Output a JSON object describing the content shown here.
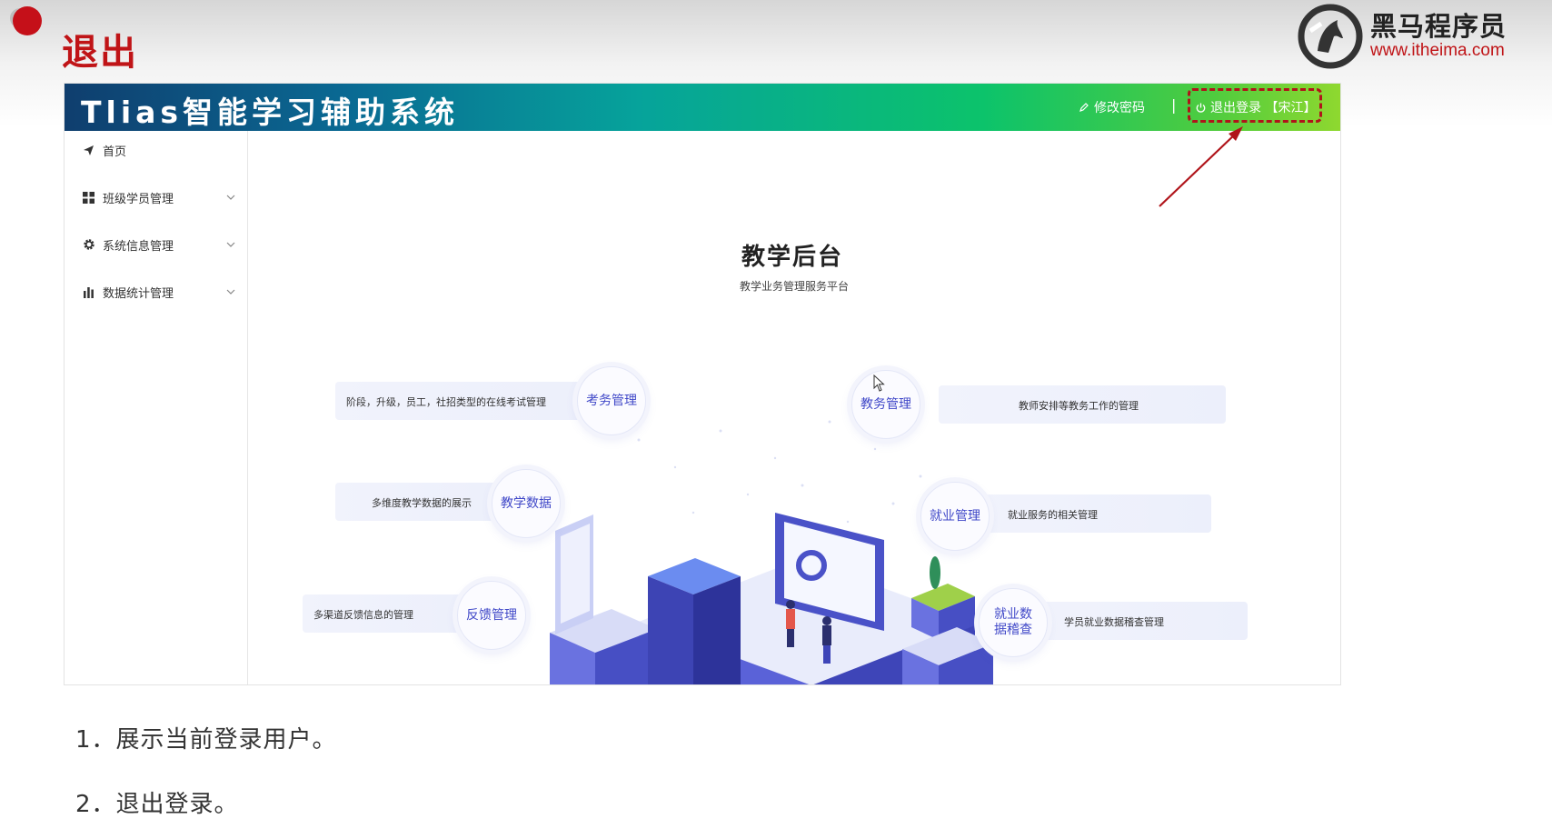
{
  "slide": {
    "title": "退出",
    "brand_name": "黑马程序员",
    "brand_url": "www.itheima.com"
  },
  "app": {
    "title": "Tlias智能学习辅助系统",
    "header": {
      "change_password": "修改密码",
      "separator": "|",
      "logout": "退出登录 【宋江】"
    },
    "sidebar": {
      "items": [
        {
          "label": "首页",
          "icon": "paper-plane-icon",
          "expandable": false
        },
        {
          "label": "班级学员管理",
          "icon": "grid-icon",
          "expandable": true
        },
        {
          "label": "系统信息管理",
          "icon": "gear-icon",
          "expandable": true
        },
        {
          "label": "数据统计管理",
          "icon": "bar-chart-icon",
          "expandable": true
        }
      ]
    },
    "main": {
      "title": "教学后台",
      "subtitle": "教学业务管理服务平台",
      "features": [
        {
          "name": "考务管理",
          "desc": "阶段，升级，员工，社招类型的在线考试管理"
        },
        {
          "name": "教学数据",
          "desc": "多维度教学数据的展示"
        },
        {
          "name": "反馈管理",
          "desc": "多渠道反馈信息的管理"
        },
        {
          "name": "教务管理",
          "desc": "教师安排等教务工作的管理"
        },
        {
          "name": "就业管理",
          "desc": "就业服务的相关管理"
        },
        {
          "name": "就业数据稽查",
          "desc": "学员就业数据稽查管理"
        }
      ]
    }
  },
  "notes": [
    "1．展示当前登录用户。",
    "2．退出登录。"
  ],
  "colors": {
    "accent_red": "#c01417",
    "header_start": "#0f3e6e",
    "header_end": "#8fd82f",
    "feature_text": "#4048c8"
  }
}
